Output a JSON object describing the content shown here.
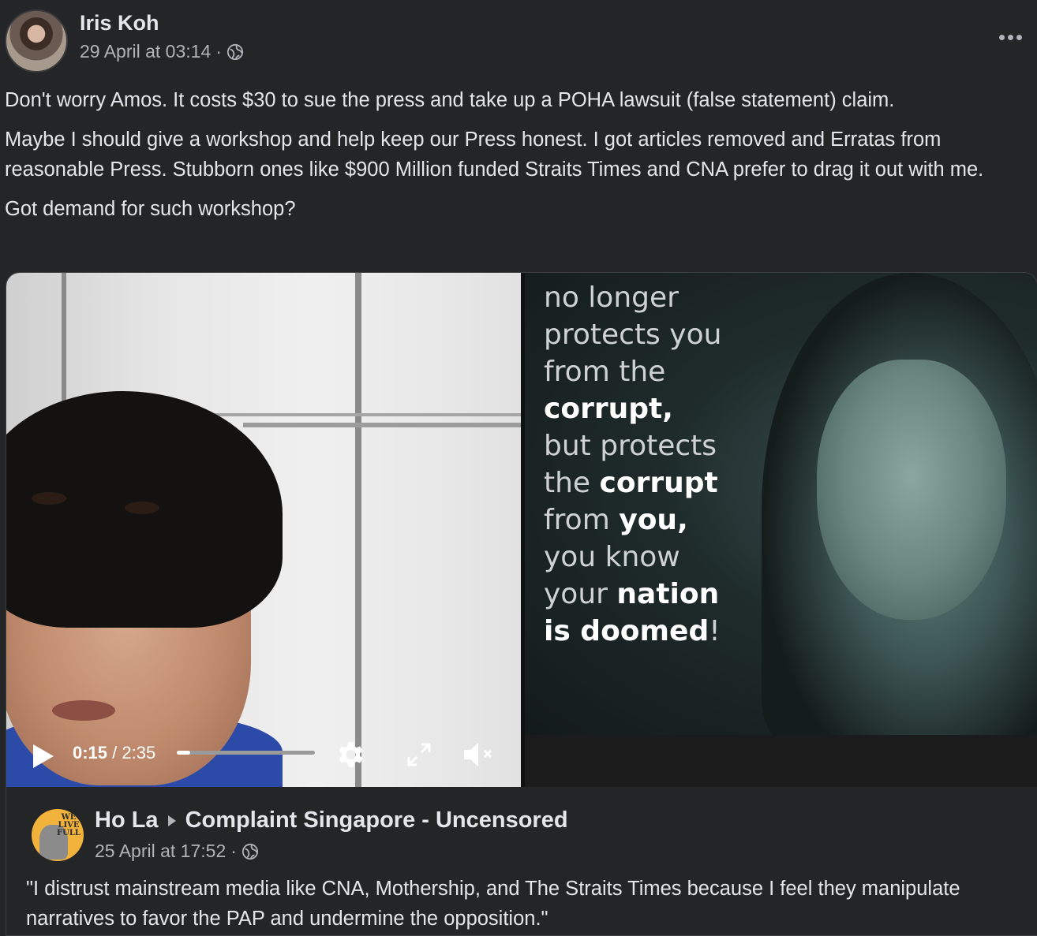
{
  "post": {
    "author": "Iris Koh",
    "timestamp": "29 April at 03:14",
    "separator": "·",
    "privacy_icon": "globe-icon",
    "more_icon": "more-options-icon",
    "paragraphs": [
      "Don't worry Amos. It costs $30 to sue the press and take up a POHA lawsuit (false statement) claim.",
      "Maybe I should give a workshop and help keep our Press honest. I got articles removed  and Erratas from reasonable Press. Stubborn ones like $900 Million funded Straits Times and CNA prefer to drag it out with me.",
      "Got demand for such workshop?"
    ]
  },
  "video": {
    "current_time": "0:15",
    "time_separator": " / ",
    "duration": "2:35",
    "progress_fraction": 0.097,
    "quote_lines": [
      {
        "pre": "no longer",
        "bold": "",
        "post": ""
      },
      {
        "pre": "protects you",
        "bold": "",
        "post": ""
      },
      {
        "pre": "from the",
        "bold": "",
        "post": ""
      },
      {
        "pre": "",
        "bold": "corrupt",
        "post": ","
      },
      {
        "pre": "but protects",
        "bold": "",
        "post": ""
      },
      {
        "pre": "the ",
        "bold": "corrupt",
        "post": ""
      },
      {
        "pre": "from ",
        "bold": "you,",
        "post": ""
      },
      {
        "pre": "you know",
        "bold": "",
        "post": ""
      },
      {
        "pre": "your ",
        "bold": "nation",
        "post": ""
      },
      {
        "pre": "",
        "bold": "is doomed",
        "post": "!"
      }
    ]
  },
  "shared_post": {
    "author": "Ho La",
    "group": "Complaint Singapore - Uncensored",
    "timestamp": "25 April at 17:52",
    "separator": "·",
    "avatar_text": "WE LIVE FULL",
    "text": "\"I distrust mainstream media like CNA, Mothership, and The Straits Times because I feel they manipulate narratives to favor the PAP and undermine the opposition.\""
  },
  "colors": {
    "background": "#242526",
    "text_primary": "#e4e6eb",
    "text_secondary": "#b0b3b8"
  }
}
